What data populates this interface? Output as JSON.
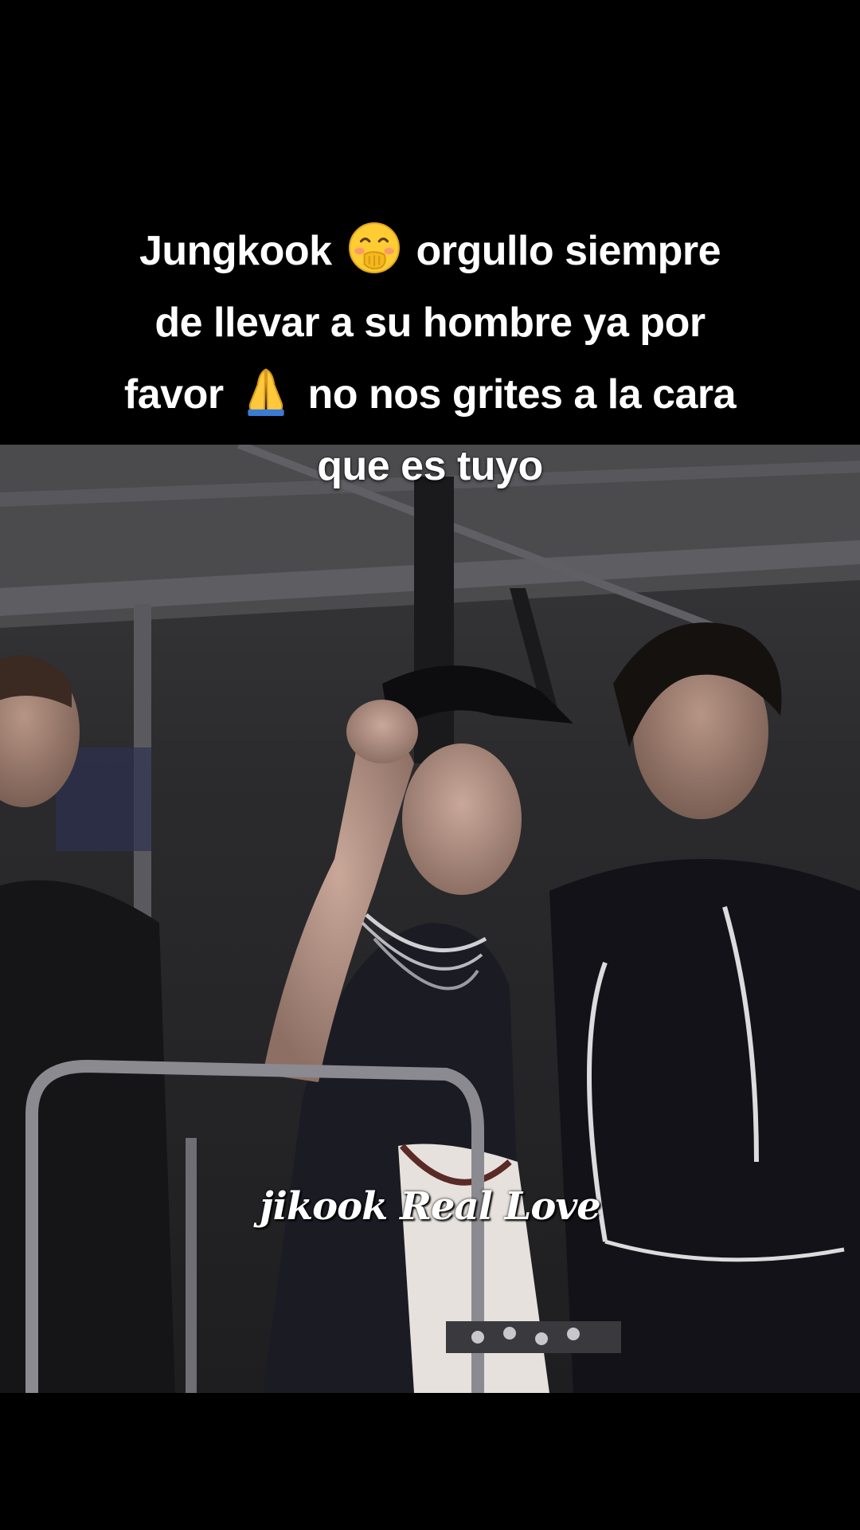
{
  "caption": {
    "line1_before": "Jungkook",
    "line1_emoji": "face-with-hand-over-mouth-emoji",
    "line1_after": "orgullo siempre",
    "line2": "de llevar a su hombre ya por",
    "line3_before": "favor",
    "line3_emoji": "folded-hands-emoji",
    "line3_after": "no nos grites a la cara",
    "line4": "que es tuyo"
  },
  "watermark": {
    "text": "jikook Real Love"
  },
  "colors": {
    "background": "#000000",
    "caption_text": "#ffffff",
    "video_tone": "#2a2a2c"
  }
}
